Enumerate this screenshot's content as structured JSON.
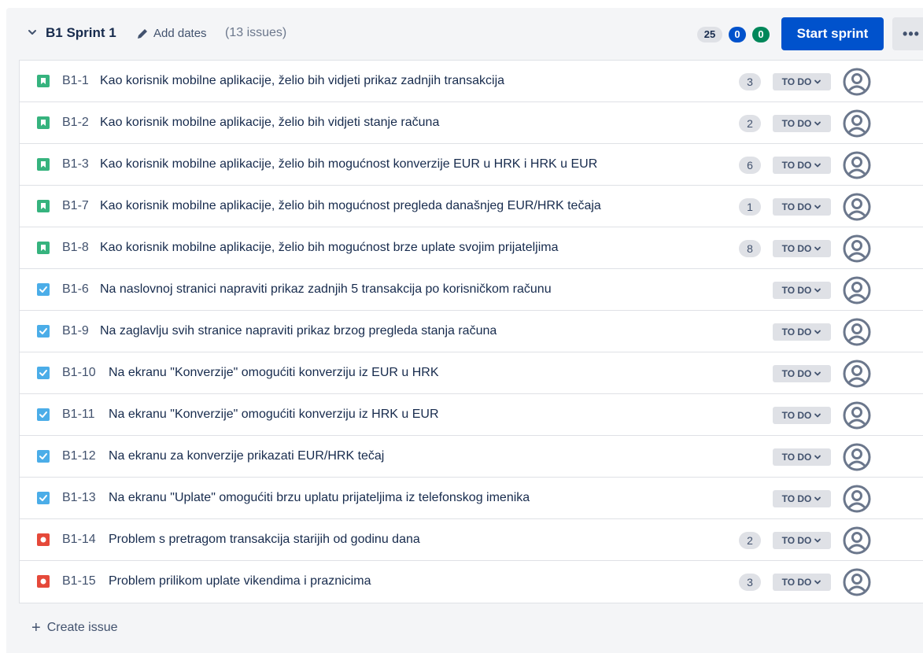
{
  "sprint": {
    "title": "B1 Sprint 1",
    "add_dates_label": "Add dates",
    "issue_count": "(13 issues)",
    "counts": {
      "todo": "25",
      "in_progress": "0",
      "done": "0"
    },
    "start_label": "Start sprint",
    "more_label": "•••",
    "create_label": "Create issue"
  },
  "colors": {
    "story": "#36b37e",
    "task": "#4bade8",
    "bug": "#e5493a",
    "primary": "#0052cc",
    "done": "#00875a"
  },
  "issues": [
    {
      "key": "B1-1",
      "summary": "Kao korisnik mobilne aplikacije, želio bih vidjeti prikaz zadnjih transakcija",
      "type": "story",
      "points": "3",
      "status": "TO DO"
    },
    {
      "key": "B1-2",
      "summary": "Kao korisnik mobilne aplikacije, želio bih vidjeti stanje računa",
      "type": "story",
      "points": "2",
      "status": "TO DO"
    },
    {
      "key": "B1-3",
      "summary": "Kao korisnik mobilne aplikacije, želio bih mogućnost konverzije EUR u HRK i HRK u EUR",
      "type": "story",
      "points": "6",
      "status": "TO DO"
    },
    {
      "key": "B1-7",
      "summary": "Kao korisnik mobilne aplikacije, želio bih mogućnost pregleda današnjeg EUR/HRK tečaja",
      "type": "story",
      "points": "1",
      "status": "TO DO"
    },
    {
      "key": "B1-8",
      "summary": "Kao korisnik mobilne aplikacije, želio bih mogućnost brze uplate svojim prijateljima",
      "type": "story",
      "points": "8",
      "status": "TO DO"
    },
    {
      "key": "B1-6",
      "summary": "Na naslovnoj stranici napraviti prikaz zadnjih 5 transakcija po korisničkom računu",
      "type": "task",
      "points": "",
      "status": "TO DO"
    },
    {
      "key": "B1-9",
      "summary": "Na zaglavlju svih stranice napraviti prikaz brzog pregleda stanja računa",
      "type": "task",
      "points": "",
      "status": "TO DO"
    },
    {
      "key": "B1-10",
      "summary": "Na ekranu \"Konverzije\" omogućiti konverziju iz EUR u HRK",
      "type": "task",
      "points": "",
      "status": "TO DO"
    },
    {
      "key": "B1-11",
      "summary": "Na ekranu \"Konverzije\" omogućiti konverziju iz HRK u EUR",
      "type": "task",
      "points": "",
      "status": "TO DO"
    },
    {
      "key": "B1-12",
      "summary": "Na ekranu za konverzije prikazati EUR/HRK tečaj",
      "type": "task",
      "points": "",
      "status": "TO DO"
    },
    {
      "key": "B1-13",
      "summary": "Na ekranu \"Uplate\" omogućiti brzu uplatu prijateljima iz telefonskog imenika",
      "type": "task",
      "points": "",
      "status": "TO DO"
    },
    {
      "key": "B1-14",
      "summary": "Problem s pretragom transakcija starijih od godinu dana",
      "type": "bug",
      "points": "2",
      "status": "TO DO"
    },
    {
      "key": "B1-15",
      "summary": "Problem prilikom uplate vikendima i praznicima",
      "type": "bug",
      "points": "3",
      "status": "TO DO"
    }
  ]
}
